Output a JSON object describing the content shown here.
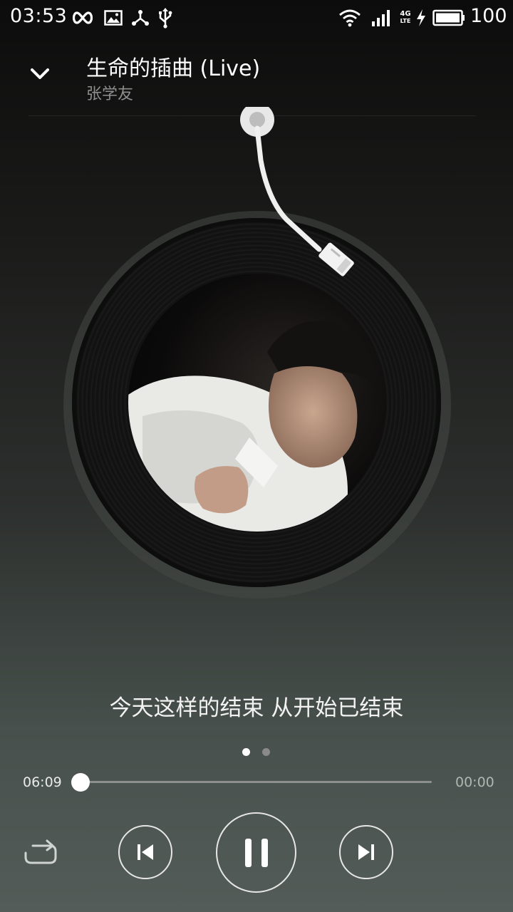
{
  "status_bar": {
    "time": "03:53",
    "battery_level": "100",
    "icons": [
      "infinity-icon",
      "image-icon",
      "share-icon",
      "usb-icon",
      "wifi-icon",
      "signal-icon",
      "network-4g-lte-icon",
      "charging-icon",
      "battery-icon"
    ],
    "network_label_top": "4G",
    "network_label_bottom": "LTE"
  },
  "header": {
    "song_title": "生命的插曲 (Live)",
    "artist": "张学友",
    "collapse_icon": "chevron-down-icon"
  },
  "player": {
    "lyric_line": "今天这样的结束 从开始已结束",
    "page_count": 2,
    "active_page": 1,
    "elapsed_time": "06:09",
    "total_time": "00:00",
    "progress": 0.0,
    "is_playing": true,
    "controls": [
      "repeat-icon",
      "previous-icon",
      "pause-icon",
      "next-icon"
    ]
  },
  "colors": {
    "accent": "#ffffff",
    "artist_text": "#8f8f8f",
    "track": "#8c8f8d"
  }
}
